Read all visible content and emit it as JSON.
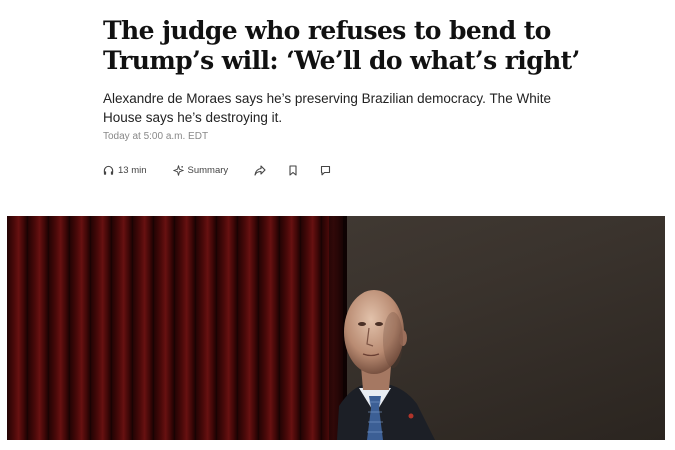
{
  "article": {
    "headline": "The judge who refuses to bend to Trump’s will: ‘We’ll do what’s right’",
    "dek": "Alexandre de Moraes says he’s preserving Brazilian democracy. The White House says he’s destroying it.",
    "timestamp": "Today at 5:00 a.m. EDT"
  },
  "toolbar": {
    "listen_label": "13 min",
    "summary_label": "Summary",
    "icons": [
      "headphones-icon",
      "sparkle-icon",
      "share-icon",
      "bookmark-icon",
      "comment-icon"
    ]
  },
  "colors": {
    "curtain": "#5a0c0c",
    "wall": "#3a342e",
    "headline": "#111111",
    "meta": "#888888"
  }
}
